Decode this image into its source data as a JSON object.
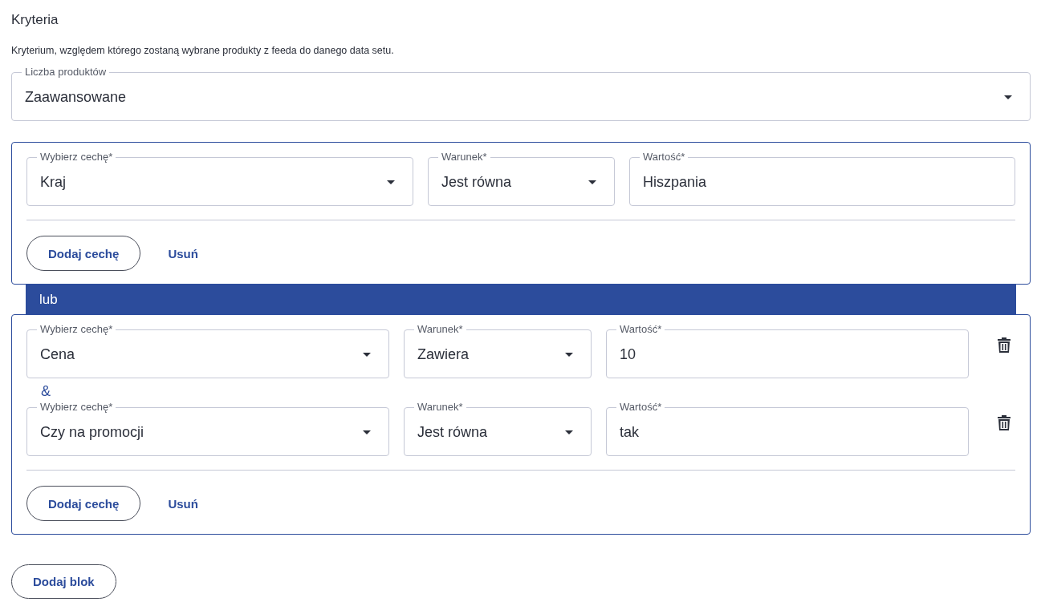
{
  "title": "Kryteria",
  "description": "Kryterium, względem którego zostaną wybrane produkty z feeda do danego data setu.",
  "count_field": {
    "label": "Liczba produktów",
    "value": "Zaawansowane"
  },
  "blocks": [
    {
      "show_delete": false,
      "conditions": [
        {
          "fields": [
            {
              "kind": "select",
              "label": "Wybierz cechę*",
              "value": "Kraj"
            },
            {
              "kind": "select",
              "label": "Warunek*",
              "value": "Jest równa"
            },
            {
              "kind": "input",
              "label": "Wartość*",
              "value": "Hiszpania"
            }
          ]
        }
      ],
      "add_feature": "Dodaj cechę",
      "remove": "Usuń"
    },
    {
      "separator_before": "lub",
      "joiner": "&",
      "show_delete": true,
      "conditions": [
        {
          "fields": [
            {
              "kind": "select",
              "label": "Wybierz cechę*",
              "value": "Cena"
            },
            {
              "kind": "select",
              "label": "Warunek*",
              "value": "Zawiera"
            },
            {
              "kind": "input",
              "label": "Wartość*",
              "value": "10"
            }
          ]
        },
        {
          "fields": [
            {
              "kind": "select",
              "label": "Wybierz cechę*",
              "value": "Czy na promocji"
            },
            {
              "kind": "select",
              "label": "Warunek*",
              "value": "Jest równa"
            },
            {
              "kind": "input",
              "label": "Wartość*",
              "value": "tak"
            }
          ]
        }
      ],
      "add_feature": "Dodaj cechę",
      "remove": "Usuń"
    }
  ],
  "add_block": "Dodaj blok"
}
